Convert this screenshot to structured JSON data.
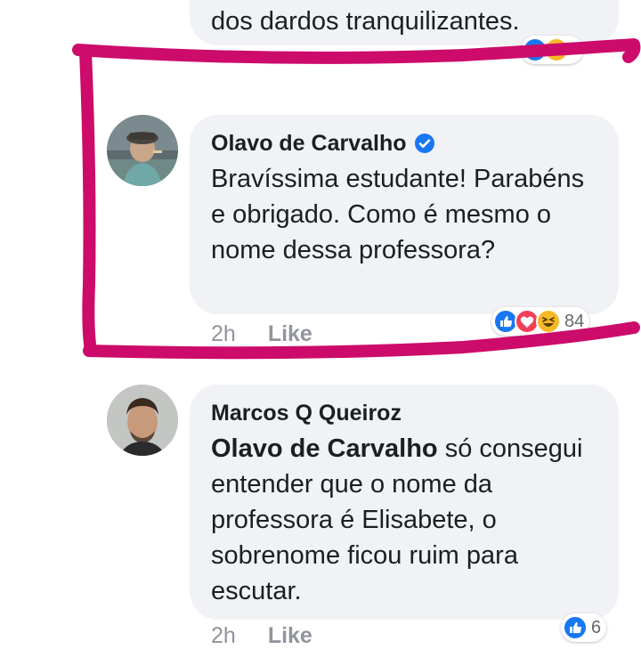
{
  "thread": {
    "previous_comment": {
      "text": "dos dardos tranquilizantes."
    },
    "main_comment": {
      "author": "Olavo de Carvalho",
      "verified": true,
      "text": "Bravíssima estudante! Parabéns e obrigado. Como é mesmo o nome dessa professora?",
      "time": "2h",
      "like_label": "Like",
      "reactions": [
        "like-icon",
        "love-icon",
        "haha-icon"
      ],
      "reaction_count": "84"
    },
    "reply_comment": {
      "author": "Marcos Q Queiroz",
      "mention": "Olavo de Carvalho",
      "text": " só consegui entender que o nome da professora é Elisabete, o sobrenome ficou ruim para escutar.",
      "time": "2h",
      "like_label": "Like",
      "reactions": [
        "like-icon"
      ],
      "reaction_count": "6"
    }
  },
  "colors": {
    "bubble": "#f0f2f5",
    "meta_text": "#90949c",
    "annotation": "#cc0b6b",
    "like_blue": "#1877f2",
    "love_red": "#f33e58",
    "haha_yellow": "#f7b928"
  }
}
